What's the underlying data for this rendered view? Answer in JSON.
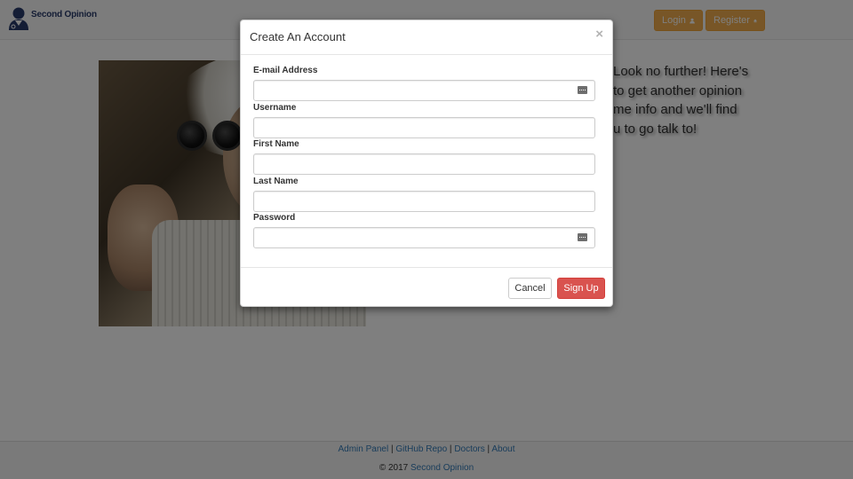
{
  "navbar": {
    "brand": "Second Opinion",
    "login_label": "Login",
    "register_label": "Register",
    "accent_color": "#f0ad4e"
  },
  "hero": {
    "lines": [
      "Look no further! Here's",
      "to get another opinion",
      "me info and we'll find",
      "u to go talk to!"
    ]
  },
  "modal": {
    "title": "Create An Account",
    "close": "×",
    "fields": [
      {
        "label": "E-mail Address",
        "value": "",
        "icon": "autofill-key-icon"
      },
      {
        "label": "Username",
        "value": ""
      },
      {
        "label": "First Name",
        "value": ""
      },
      {
        "label": "Last Name",
        "value": ""
      },
      {
        "label": "Password",
        "value": "",
        "icon": "autofill-key-icon"
      }
    ],
    "cancel_label": "Cancel",
    "signup_label": "Sign Up",
    "signup_color": "#d9534f"
  },
  "footer": {
    "links": [
      "Admin Panel",
      "GitHub Repo",
      "Doctors",
      "About"
    ],
    "separator": " | ",
    "copyright": "© 2017",
    "copyright_link": "Second Opinion"
  }
}
